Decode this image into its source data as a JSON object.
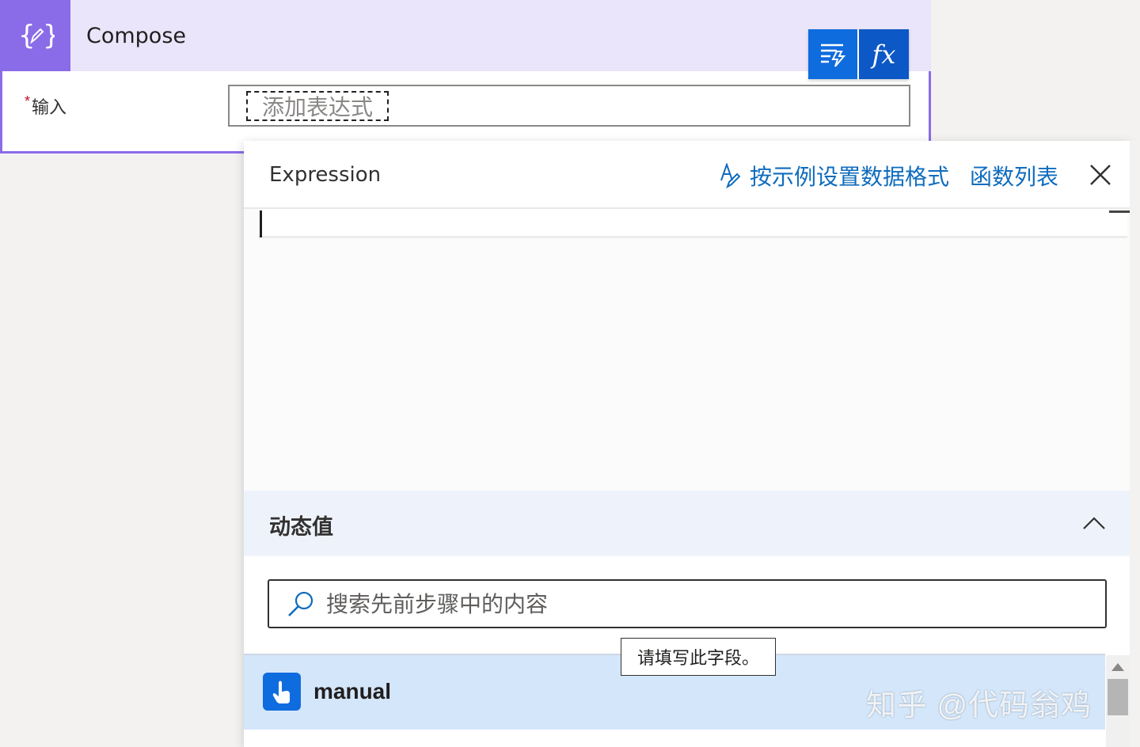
{
  "compose": {
    "title": "Compose",
    "field_label": "输入",
    "required_mark": "*",
    "expression_token": "添加表达式"
  },
  "toolbar": {
    "dynamic_content_icon": "dynamic-content-icon",
    "expression_label": "fx"
  },
  "expression_panel": {
    "title": "Expression",
    "format_by_example": "按示例设置数据格式",
    "function_list": "函数列表",
    "expression_value": ""
  },
  "dynamic_content": {
    "title": "动态值",
    "search_placeholder": "搜索先前步骤中的内容",
    "tooltip": "请填写此字段。",
    "items": [
      {
        "label": "manual",
        "icon": "touch-trigger-icon"
      }
    ]
  },
  "watermark": "知乎 @代码翁鸡",
  "colors": {
    "compose_accent": "#8a6ce8",
    "compose_header_bg": "#ebe5fb",
    "primary_blue": "#0f6cde",
    "link_blue": "#0f6cbd",
    "selected_row_bg": "#d4e6fa"
  }
}
